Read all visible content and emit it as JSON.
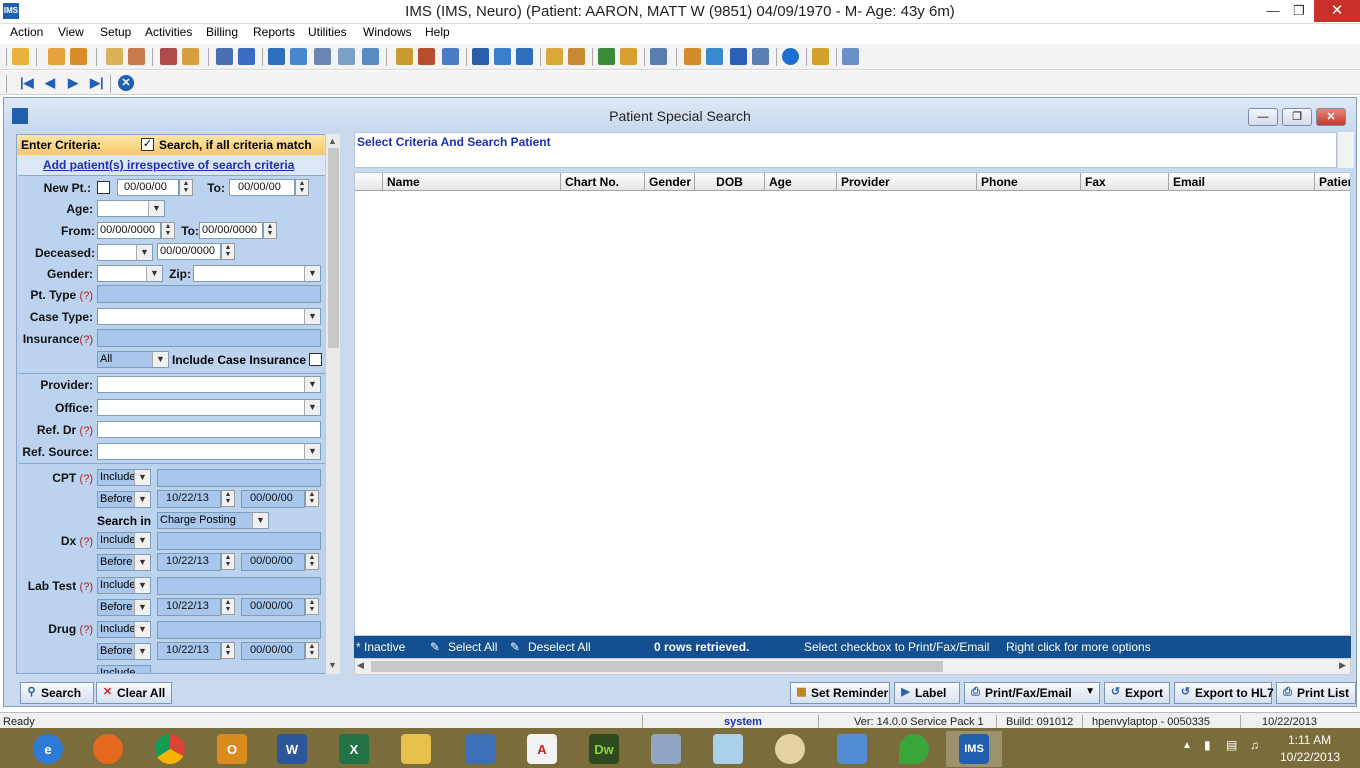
{
  "window": {
    "title": "IMS (IMS, Neuro)     (Patient: AARON, MATT W (9851) 04/09/1970 - M- Age: 43y 6m)",
    "app_icon": "IMS"
  },
  "menu": [
    "Action",
    "View",
    "Setup",
    "Activities",
    "Billing",
    "Reports",
    "Utilities",
    "Windows",
    "Help"
  ],
  "inner": {
    "title": "Patient Special Search"
  },
  "criteria": {
    "enter_criteria": "Enter Criteria:",
    "match_all": "Search, if all criteria match",
    "add_patients_link": "Add patient(s) irrespective of search criteria",
    "new_pt": "New Pt.:",
    "new_pt_from": "00/00/00",
    "to": "To:",
    "new_pt_to": "00/00/00",
    "age": "Age:",
    "from": "From:",
    "from_date": "00/00/0000",
    "to_date": "00/00/0000",
    "deceased": "Deceased:",
    "deceased_date": "00/00/0000",
    "gender": "Gender:",
    "zip": "Zip:",
    "pt_type": "Pt. Type",
    "case_type": "Case Type:",
    "insurance": "Insurance",
    "insurance_scope": "All",
    "include_case_insurance": "Include Case Insurance",
    "provider": "Provider:",
    "office": "Office:",
    "ref_dr": "Ref. Dr",
    "ref_source": "Ref. Source:",
    "help_marker": "(?)",
    "cpt": "CPT",
    "dx": "Dx",
    "lab_test": "Lab Test",
    "drug": "Drug",
    "include": "Include",
    "before": "Before",
    "before_date": "10/22/13",
    "zero_date": "00/00/00",
    "search_in": "Search in",
    "search_in_value": "Charge Posting"
  },
  "right": {
    "criteria_text": "Select Criteria And Search Patient",
    "columns": [
      "Name",
      "Chart No.",
      "Gender",
      "DOB",
      "Age",
      "Provider",
      "Phone",
      "Fax",
      "Email",
      "Patien"
    ],
    "status": {
      "inactive": "* Inactive",
      "select_all": "Select All",
      "deselect_all": "Deselect All",
      "rows": "0 rows retrieved.",
      "hint1": "Select checkbox to Print/Fax/Email",
      "hint2": "Right click for more options"
    }
  },
  "buttons": {
    "search": "Search",
    "clear_all": "Clear All",
    "set_reminder": "Set Reminder",
    "label": "Label",
    "print_fax_email": "Print/Fax/Email",
    "export": "Export",
    "export_hl7": "Export to HL7",
    "print_list": "Print List"
  },
  "statusbar": {
    "ready": "Ready",
    "user": "system",
    "version": "Ver: 14.0.0 Service Pack 1",
    "build": "Build: 091012",
    "machine": "hpenvylaptop - 0050335",
    "date": "10/22/2013"
  },
  "taskbar": {
    "apps": [
      "internet-explorer",
      "firefox",
      "chrome",
      "outlook",
      "word",
      "excel",
      "file-explorer",
      "remote-desktop",
      "acrobat",
      "dreamweaver",
      "calculator",
      "notepad",
      "paint",
      "control-panel",
      "green-app",
      "ims"
    ],
    "time": "1:11 AM",
    "date": "10/22/2013"
  }
}
